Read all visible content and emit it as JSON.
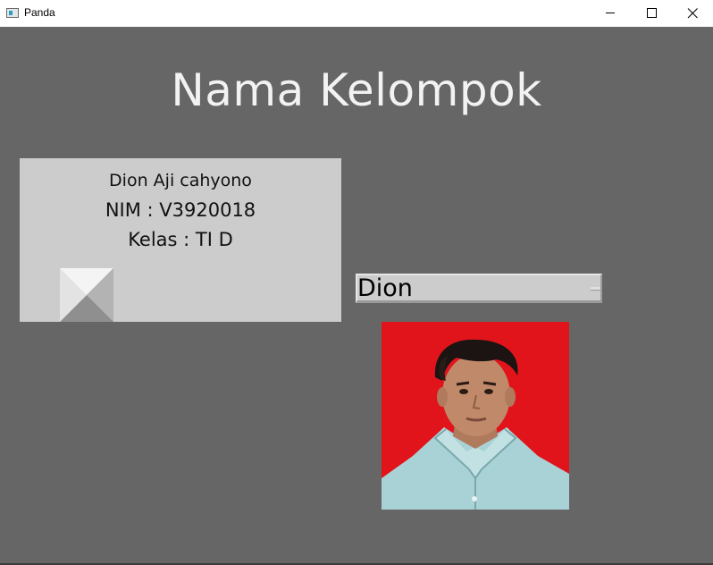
{
  "window": {
    "title": "Panda",
    "icon": "panda-app-icon",
    "controls": {
      "minimize_icon": "minimize-icon",
      "maximize_icon": "maximize-icon",
      "close_icon": "close-icon"
    }
  },
  "main": {
    "heading": "Nama Kelompok",
    "background_color": "#666666"
  },
  "info_panel": {
    "name": "Dion Aji cahyono",
    "nim": "NIM : V3920018",
    "kelas": "Kelas : TI D",
    "image_icon": "broken-image-icon"
  },
  "member_select": {
    "selected": "Dion"
  },
  "photo": {
    "background_color": "#e0141a"
  }
}
